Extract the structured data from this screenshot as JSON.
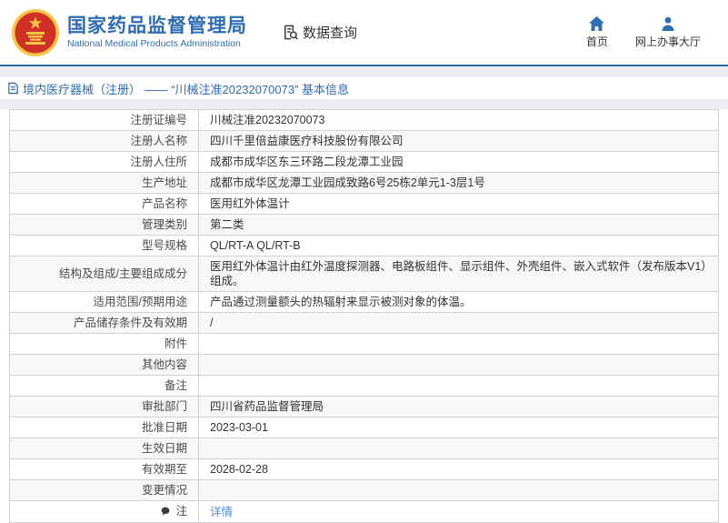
{
  "header": {
    "agency_name_zh": "国家药品监督管理局",
    "agency_name_en": "National Medical Products Administration",
    "section_title": "数据查询",
    "nav": [
      {
        "label": "首页",
        "icon": "home-icon"
      },
      {
        "label": "网上办事大厅",
        "icon": "person-icon"
      }
    ]
  },
  "breadcrumb": {
    "icon": "document-icon",
    "text": "境内医疗器械（注册） —— “川械注准20232070073” 基本信息"
  },
  "table": {
    "rows": [
      {
        "label": "注册证编号",
        "value": "川械注准20232070073"
      },
      {
        "label": "注册人名称",
        "value": "四川千里倍益康医疗科技股份有限公司"
      },
      {
        "label": "注册人住所",
        "value": "成都市成华区东三环路二段龙潭工业园"
      },
      {
        "label": "生产地址",
        "value": "成都市成华区龙潭工业园成致路6号25栋2单元1-3层1号"
      },
      {
        "label": "产品名称",
        "value": "医用红外体温计"
      },
      {
        "label": "管理类别",
        "value": "第二类"
      },
      {
        "label": "型号规格",
        "value": "QL/RT-A QL/RT-B"
      },
      {
        "label": "结构及组成/主要组成成分",
        "value": "医用红外体温计由红外温度探测器、电路板组件、显示组件、外壳组件、嵌入式软件（发布版本V1）组成。"
      },
      {
        "label": "适用范围/预期用途",
        "value": "产品通过测量额头的热辐射来显示被测对象的体温。"
      },
      {
        "label": "产品储存条件及有效期",
        "value": "/"
      },
      {
        "label": "附件",
        "value": ""
      },
      {
        "label": "其他内容",
        "value": ""
      },
      {
        "label": "备注",
        "value": ""
      },
      {
        "label": "审批部门",
        "value": "四川省药品监督管理局"
      },
      {
        "label": "批准日期",
        "value": "2023-03-01"
      },
      {
        "label": "生效日期",
        "value": ""
      },
      {
        "label": "有效期至",
        "value": "2028-02-28"
      },
      {
        "label": "变更情况",
        "value": ""
      },
      {
        "label": "注",
        "value": "详情",
        "link": true,
        "icon": "note-icon"
      }
    ]
  },
  "colors": {
    "accent_blue": "#2e6cb5",
    "link_blue": "#4a90d9",
    "emblem_red": "#d03025",
    "emblem_gold": "#f5c543",
    "row_alt_bg": "#f7f7f8",
    "border": "#d2d2d2"
  }
}
